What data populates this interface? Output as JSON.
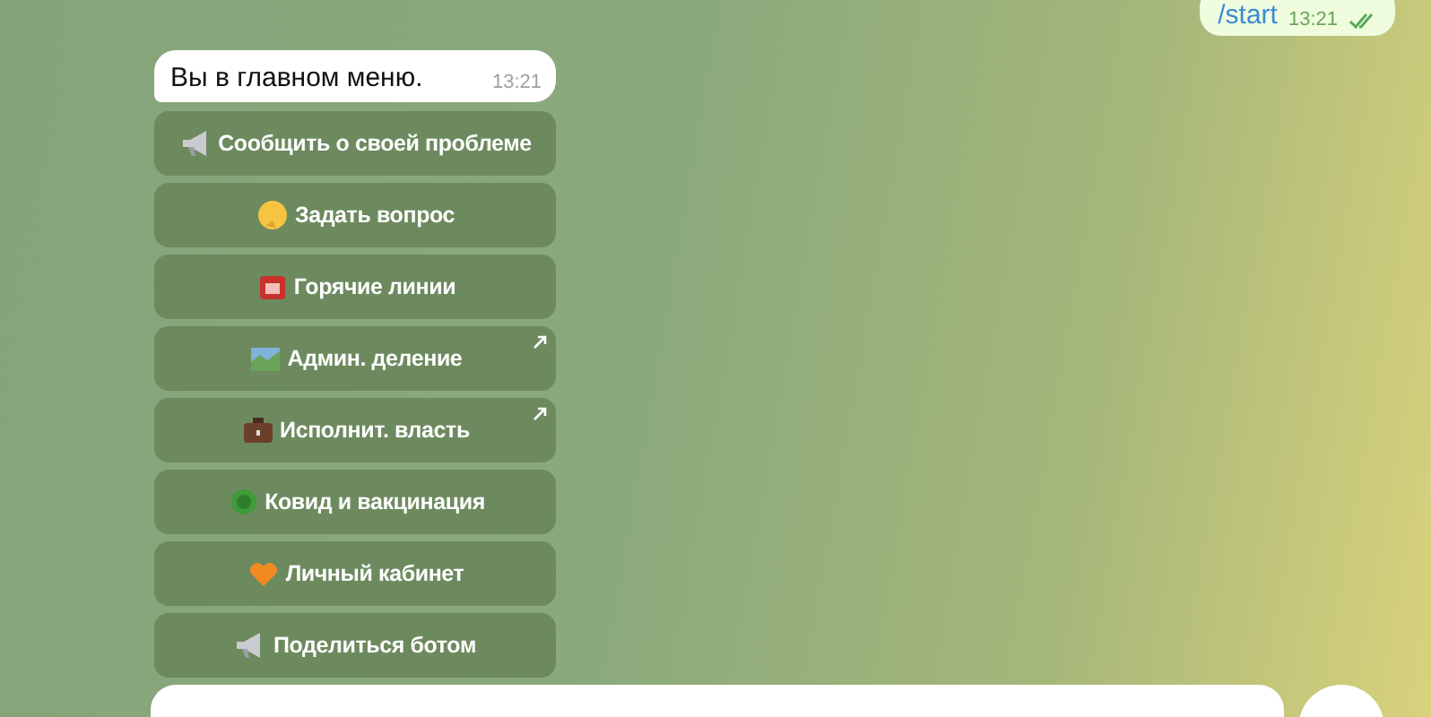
{
  "outgoing_message": {
    "text": "/start",
    "time": "13:21",
    "read": true
  },
  "incoming_message": {
    "text": "Вы в главном меню.",
    "time": "13:21"
  },
  "keyboard": [
    {
      "label": "Сообщить о своей проблеме",
      "link": false
    },
    {
      "label": "Задать вопрос",
      "link": false
    },
    {
      "label": "Горячие линии",
      "link": false
    },
    {
      "label": "Админ. деление",
      "link": true
    },
    {
      "label": "Исполнит. власть",
      "link": true
    },
    {
      "label": "Ковид и вакцинация",
      "link": false
    },
    {
      "label": "Личный кабинет",
      "link": false
    },
    {
      "label": "Поделиться ботом",
      "link": false
    }
  ]
}
